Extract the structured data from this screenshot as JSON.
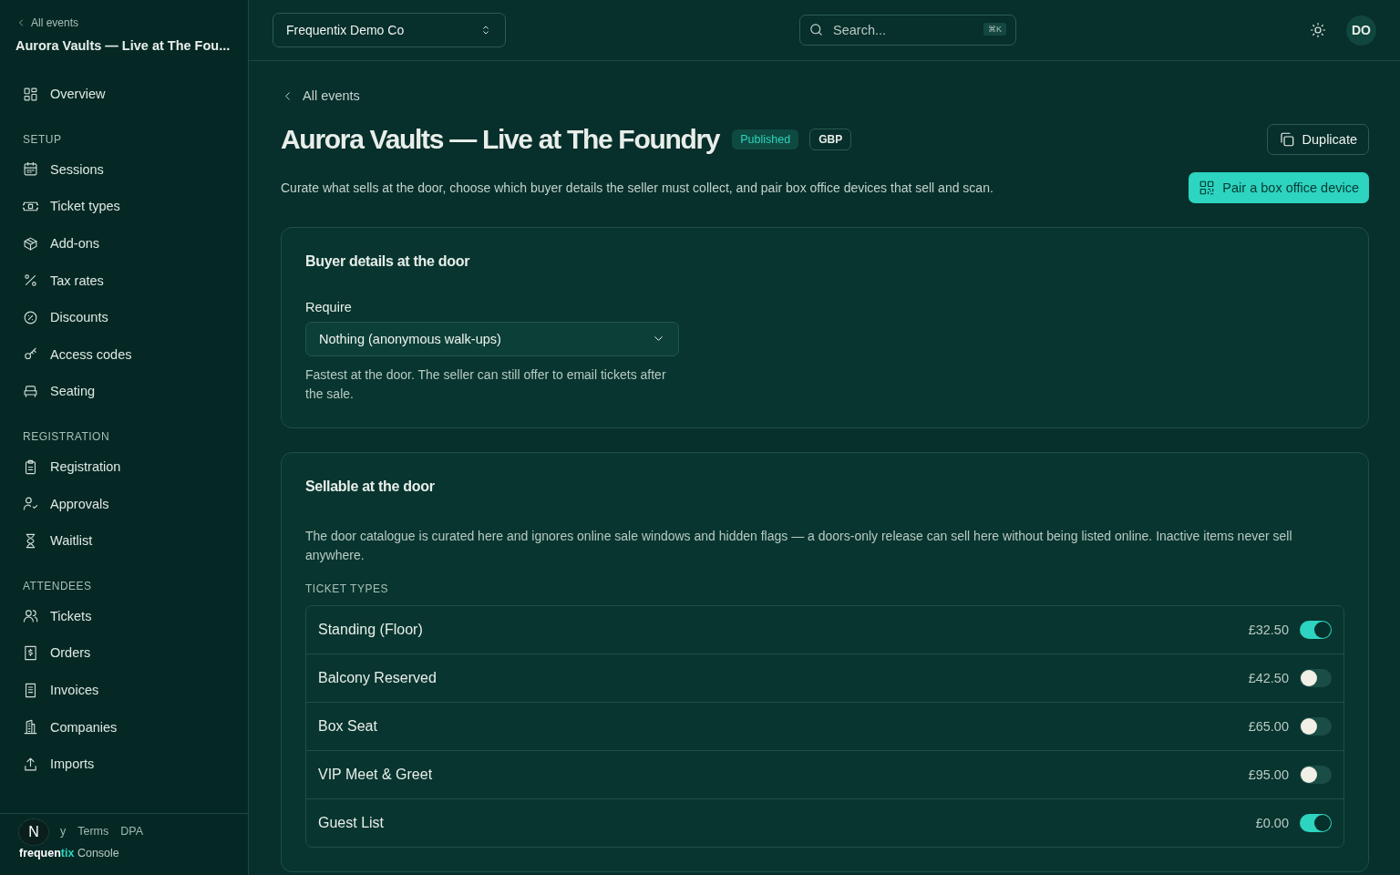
{
  "sidebar": {
    "back_link": "All events",
    "event_title": "Aurora Vaults — Live at The Fou...",
    "sections": [
      {
        "items": [
          {
            "label": "Overview",
            "selected": false
          }
        ]
      },
      {
        "heading": "SETUP",
        "items": [
          {
            "label": "Sessions",
            "selected": false
          },
          {
            "label": "Ticket types",
            "selected": false
          },
          {
            "label": "Add-ons",
            "selected": false
          },
          {
            "label": "Tax rates",
            "selected": false
          },
          {
            "label": "Discounts",
            "selected": false
          },
          {
            "label": "Access codes",
            "selected": false
          },
          {
            "label": "Seating",
            "selected": false
          }
        ]
      },
      {
        "heading": "REGISTRATION",
        "items": [
          {
            "label": "Registration",
            "selected": false
          },
          {
            "label": "Approvals",
            "selected": false
          },
          {
            "label": "Waitlist",
            "selected": false
          }
        ]
      },
      {
        "heading": "ATTENDEES",
        "items": [
          {
            "label": "Tickets",
            "selected": false
          },
          {
            "label": "Orders",
            "selected": false
          },
          {
            "label": "Invoices",
            "selected": false
          },
          {
            "label": "Companies",
            "selected": false
          },
          {
            "label": "Imports",
            "selected": false
          }
        ]
      }
    ],
    "footer_links": [
      "y",
      "Terms",
      "DPA"
    ],
    "brand": {
      "main": "frequen",
      "accent": "tix",
      "suffix": "Console"
    },
    "dev_badge": "N"
  },
  "topbar": {
    "org_selector": "Frequentix Demo Co",
    "search": {
      "placeholder": "Search...",
      "shortcut": "⌘K"
    },
    "avatar": "DO"
  },
  "page": {
    "back_link": "All events",
    "title": "Aurora Vaults — Live at The Foundry",
    "status_badge": "Published",
    "currency_badge": "GBP",
    "duplicate_button": "Duplicate",
    "description": "Curate what sells at the door, choose which buyer details the seller must collect, and pair box office devices that sell and scan.",
    "pair_button": "Pair a box office device"
  },
  "buyer_details": {
    "title": "Buyer details at the door",
    "field_label": "Require",
    "select_value": "Nothing (anonymous walk-ups)",
    "help": "Fastest at the door. The seller can still offer to email tickets after the sale."
  },
  "sellable": {
    "title": "Sellable at the door",
    "description": "The door catalogue is curated here and ignores online sale windows and hidden flags — a doors-only release can sell here without being listed online. Inactive items never sell anywhere.",
    "group_heading": "TICKET TYPES",
    "items": [
      {
        "name": "Standing (Floor)",
        "price": "£32.50",
        "on": true
      },
      {
        "name": "Balcony Reserved",
        "price": "£42.50",
        "on": false
      },
      {
        "name": "Box Seat",
        "price": "£65.00",
        "on": false
      },
      {
        "name": "VIP Meet & Greet",
        "price": "£95.00",
        "on": false
      },
      {
        "name": "Guest List",
        "price": "£0.00",
        "on": true
      }
    ]
  }
}
